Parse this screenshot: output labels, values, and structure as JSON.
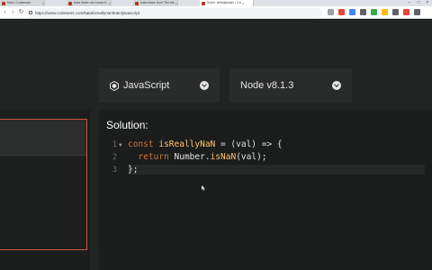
{
  "browser": {
    "tabs": [
      {
        "title": "Kata | Codewars"
      },
      {
        "title": "Kata Make me Linear 6 - Your"
      },
      {
        "title": "Kata Make Sure The Message"
      },
      {
        "title": "Solve: isReallyNaN | Codewars"
      }
    ],
    "url": "https://www.codewars.com/kata/isreallynan/train/javascript"
  },
  "language_select": {
    "value": "JavaScript"
  },
  "version_select": {
    "value": "Node v8.1.3"
  },
  "solution": {
    "title": "Solution:",
    "line_numbers": [
      "1",
      "2",
      "3"
    ]
  },
  "colors": {
    "accent": "#c9523a",
    "keyword": "#cc7832",
    "identifier": "#ffc66d"
  },
  "icons": [
    "javascript-icon",
    "chevron-down-icon",
    "lock-icon",
    "back-icon",
    "forward-icon",
    "reload-icon"
  ]
}
